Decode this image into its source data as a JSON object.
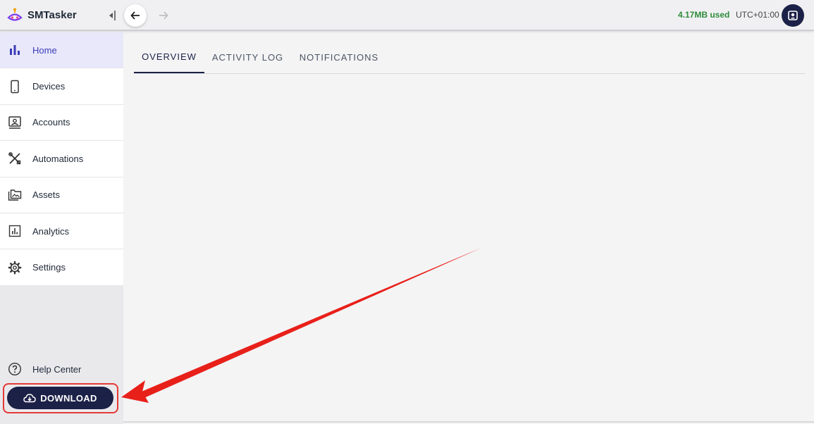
{
  "header": {
    "brand": "SMTasker",
    "storage_used": "4.17MB used",
    "timezone": "UTC+01:00"
  },
  "sidebar": {
    "items": [
      {
        "label": "Home",
        "icon": "bar-chart-icon",
        "active": true
      },
      {
        "label": "Devices",
        "icon": "phone-icon"
      },
      {
        "label": "Accounts",
        "icon": "account-card-icon"
      },
      {
        "label": "Automations",
        "icon": "tools-icon"
      },
      {
        "label": "Assets",
        "icon": "folder-image-icon"
      },
      {
        "label": "Analytics",
        "icon": "analytics-icon"
      },
      {
        "label": "Settings",
        "icon": "gear-icon"
      }
    ],
    "help_label": "Help Center",
    "download_label": "DOWNLOAD"
  },
  "tabs": [
    {
      "label": "OVERVIEW",
      "active": true
    },
    {
      "label": "ACTIVITY LOG"
    },
    {
      "label": "NOTIFICATIONS"
    }
  ],
  "colors": {
    "accent": "#1c2147",
    "active_bg": "#e8e8fa",
    "active_text": "#3b3bb8",
    "storage_green": "#2e8b3a",
    "annotation_red": "#e53935"
  }
}
